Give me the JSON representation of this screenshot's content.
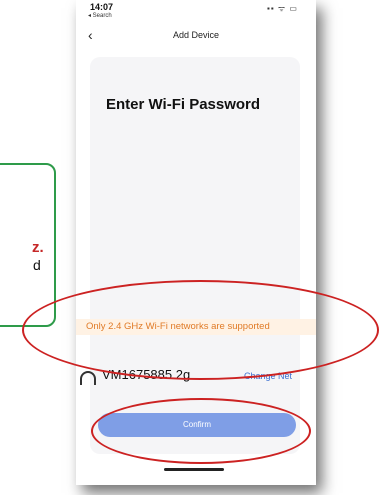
{
  "callout": {
    "line1": "z.",
    "line2": "d"
  },
  "status_bar": {
    "time": "14:07",
    "back_app": "◂ Search",
    "icons": "▪▪ ᯤ ▭"
  },
  "nav": {
    "title": "Add Device",
    "back_symbol": "‹"
  },
  "main": {
    "heading": "Enter Wi-Fi Password",
    "warning": "Only 2.4 GHz Wi-Fi networks are supported",
    "network_name": "VM1675885 2g",
    "change_network_label": "Change Net",
    "confirm_label": "Confirm"
  },
  "colors": {
    "annotation_red": "#cc2222",
    "annotation_green": "#2e9b4a",
    "button_blue": "#7f9ee6",
    "warning_orange": "#e07b27",
    "link_blue": "#3b6fd1"
  }
}
